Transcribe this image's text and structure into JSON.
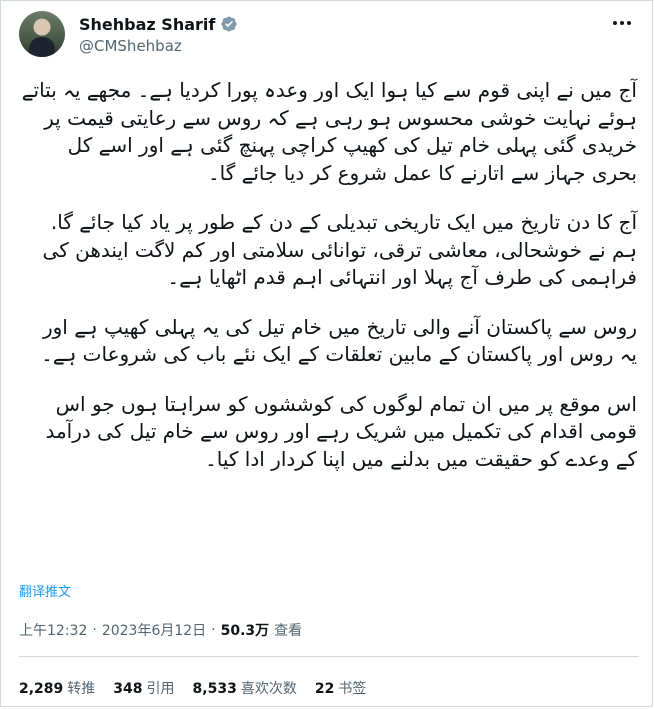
{
  "author": {
    "display_name": "Shehbaz Sharif",
    "handle": "@CMShehbaz",
    "avatar_icon": "profile-photo"
  },
  "tweet": {
    "paragraphs": [
      "آج میں نے اپنی قوم سے کیا ہوا ایک اور وعدہ پورا کردیا ہے۔ مجھے یہ بتاتے ہوئے نہایت خوشی محسوس ہو رہی ہے کہ روس سے رعایتی قیمت پر خریدی گئی پہلی خام تیل کی کھیپ کراچی پہنچ گئی ہے اور اسے کل بحری جہاز سے اتارنے کا عمل شروع کر دیا جائے گا۔",
      "آج کا دن تاریخ میں ایک تاریخی تبدیلی کے دن کے طور پر یاد کیا جائے گا. ہم نے خوشحالی، معاشی ترقی، توانائی سلامتی اور کم لاگت ایندھن کی فراہمی کی طرف آج پہلا اور انتہائی اہم قدم اٹھایا ہے۔",
      "روس سے پاکستان آنے والی تاریخ میں خام تیل کی یہ پہلی کھیپ ہے اور یہ روس اور پاکستان کے مابین تعلقات کے ایک نئے باب کی شروعات ہے۔",
      "اس موقع پر میں ان تمام لوگوں کی کوششوں کو سراہتا ہوں جو اس قومی اقدام کی تکمیل میں شریک رہے اور روس سے خام تیل کی درآمد کے وعدے کو حقیقت میں بدلنے میں اپنا کردار ادا کیا۔"
    ],
    "translate_label": "翻译推文",
    "time": "上午12:32",
    "separator": "·",
    "date": "2023年6月12日",
    "views_count": "50.3万",
    "views_label": "查看"
  },
  "stats": [
    {
      "count": "2,289",
      "label": "转推"
    },
    {
      "count": "348",
      "label": "引用"
    },
    {
      "count": "8,533",
      "label": "喜欢次数"
    },
    {
      "count": "22",
      "label": "书签"
    }
  ],
  "colors": {
    "accent": "#1d9bf0",
    "text": "#0f1419",
    "muted": "#536471",
    "border": "#cfd9de"
  }
}
